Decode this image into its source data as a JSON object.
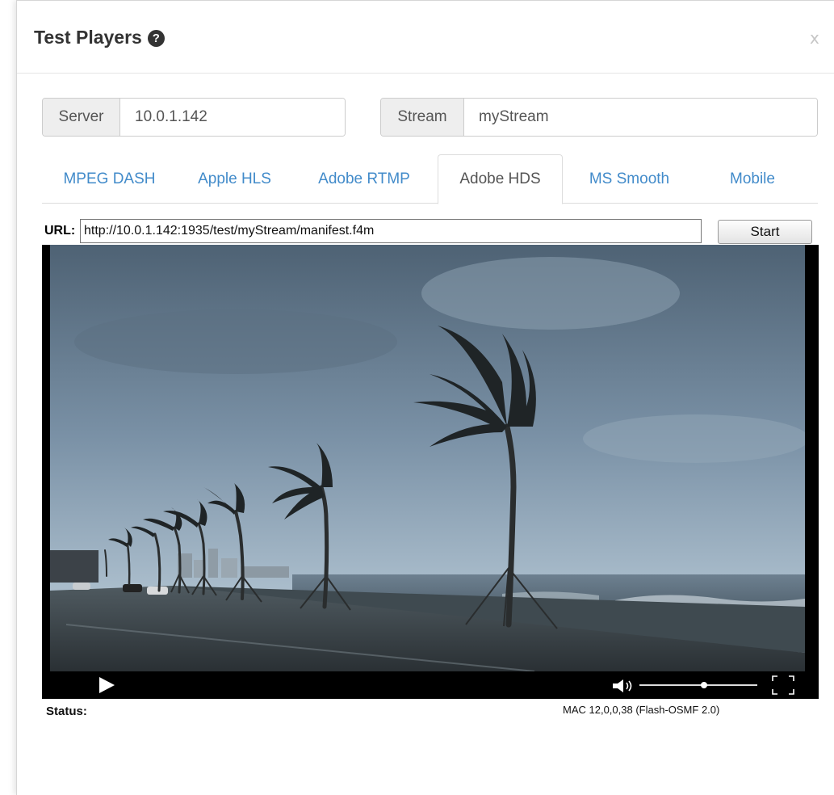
{
  "modal": {
    "title": "Test Players",
    "help_icon": "question-circle-icon",
    "close_label": "x"
  },
  "server": {
    "label": "Server",
    "value": "10.0.1.142"
  },
  "stream": {
    "label": "Stream",
    "value": "myStream"
  },
  "tabs": [
    {
      "label": "MPEG DASH",
      "active": false
    },
    {
      "label": "Apple HLS",
      "active": false
    },
    {
      "label": "Adobe RTMP",
      "active": false
    },
    {
      "label": "Adobe HDS",
      "active": true
    },
    {
      "label": "MS Smooth",
      "active": false
    },
    {
      "label": "Mobile",
      "active": false
    }
  ],
  "player": {
    "url_label": "URL:",
    "url_value": "http://10.0.1.142:1935/test/myStream/manifest.f4m",
    "start_label": "Start",
    "video_description": "storm-palm-trees-beach-video-frame",
    "controls": {
      "play_icon": "play-icon",
      "volume_icon": "volume-icon",
      "volume_level": 0.55,
      "fullscreen_icon": "fullscreen-icon"
    }
  },
  "status": {
    "label": "Status:",
    "version": "MAC 12,0,0,38 (Flash-OSMF 2.0)"
  },
  "colors": {
    "link": "#428bca",
    "addon_bg": "#eeeeee",
    "text": "#555555",
    "title": "#333333"
  }
}
